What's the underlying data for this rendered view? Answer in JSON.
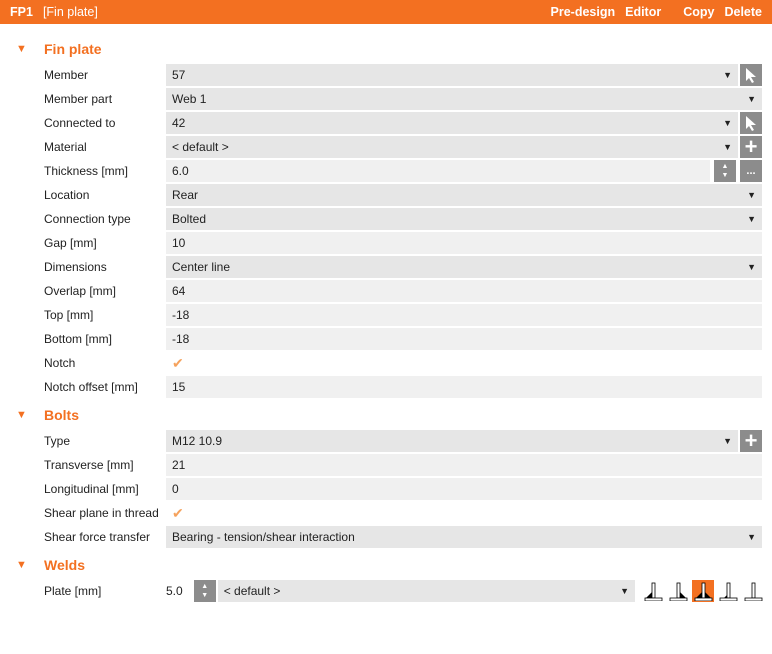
{
  "header": {
    "id": "FP1",
    "title": "[Fin plate]",
    "actions": [
      "Pre-design",
      "Editor",
      "Copy",
      "Delete"
    ]
  },
  "sections": {
    "fin_plate": {
      "title": "Fin plate",
      "rows": [
        {
          "label": "Member",
          "value": "57"
        },
        {
          "label": "Member part",
          "value": "Web 1"
        },
        {
          "label": "Connected to",
          "value": "42"
        },
        {
          "label": "Material",
          "value": "< default >"
        },
        {
          "label": "Thickness [mm]",
          "value": "6.0"
        },
        {
          "label": "Location",
          "value": "Rear"
        },
        {
          "label": "Connection type",
          "value": "Bolted"
        },
        {
          "label": "Gap [mm]",
          "value": "10"
        },
        {
          "label": "Dimensions",
          "value": "Center line"
        },
        {
          "label": "Overlap [mm]",
          "value": "64"
        },
        {
          "label": "Top [mm]",
          "value": "-18"
        },
        {
          "label": "Bottom [mm]",
          "value": "-18"
        },
        {
          "label": "Notch",
          "value": "✔"
        },
        {
          "label": "Notch offset [mm]",
          "value": "15"
        }
      ]
    },
    "bolts": {
      "title": "Bolts",
      "rows": [
        {
          "label": "Type",
          "value": "M12 10.9"
        },
        {
          "label": "Transverse [mm]",
          "value": "21"
        },
        {
          "label": "Longitudinal [mm]",
          "value": "0"
        },
        {
          "label": "Shear plane in thread",
          "value": "✔"
        },
        {
          "label": "Shear force transfer",
          "value": "Bearing - tension/shear interaction"
        }
      ]
    },
    "welds": {
      "title": "Welds",
      "rows": [
        {
          "label": "Plate [mm]",
          "value": "5.0",
          "type": "< default >"
        }
      ]
    }
  },
  "icons": {
    "dropdown": "▼",
    "more": "...",
    "plus": "+"
  },
  "colors": {
    "accent": "#f37021"
  }
}
